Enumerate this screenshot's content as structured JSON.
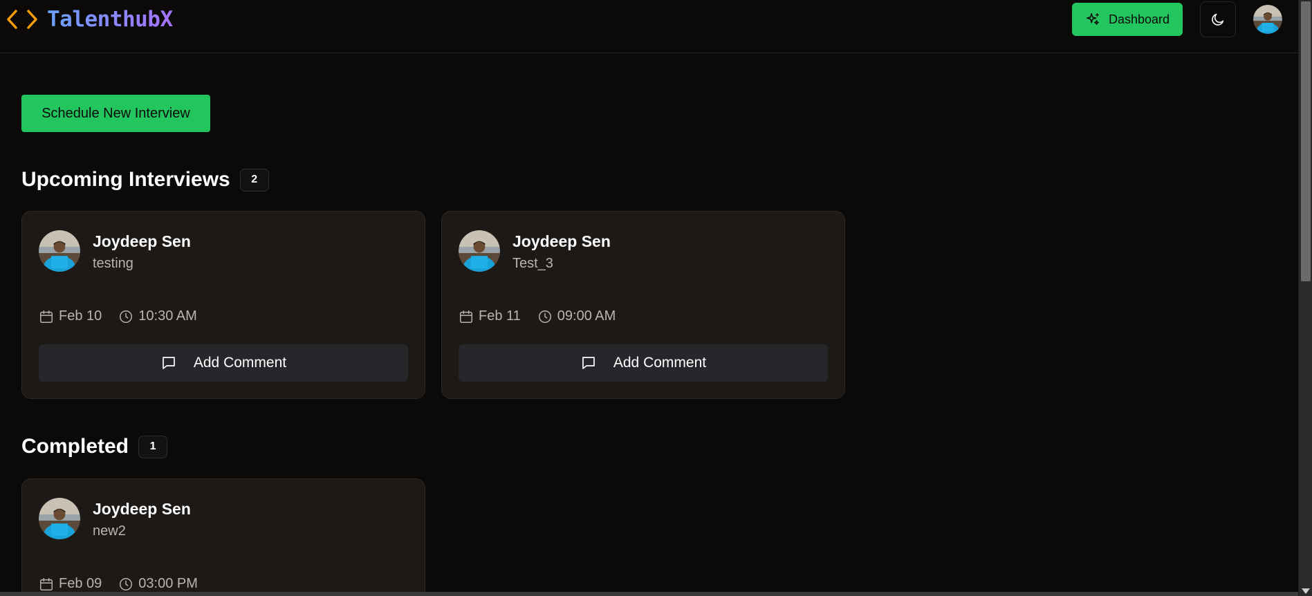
{
  "header": {
    "brand": "TalenthubX",
    "dashboard_label": "Dashboard"
  },
  "main": {
    "schedule_label": "Schedule New Interview",
    "upcoming": {
      "title": "Upcoming Interviews",
      "count": "2",
      "cards": [
        {
          "name": "Joydeep Sen",
          "title": "testing",
          "date": "Feb 10",
          "time": "10:30 AM",
          "comment_label": "Add Comment"
        },
        {
          "name": "Joydeep Sen",
          "title": "Test_3",
          "date": "Feb 11",
          "time": "09:00 AM",
          "comment_label": "Add Comment"
        }
      ]
    },
    "completed": {
      "title": "Completed",
      "count": "1",
      "cards": [
        {
          "name": "Joydeep Sen",
          "title": "new2",
          "date": "Feb 09",
          "time": "03:00 PM"
        }
      ]
    }
  },
  "icons": {
    "logo": "code-brackets-icon",
    "dashboard": "sparkles-icon",
    "theme": "moon-icon",
    "calendar": "calendar-icon",
    "clock": "clock-icon",
    "comment": "message-square-icon"
  },
  "colors": {
    "background": "#0b0a09",
    "accent": "#22c55e",
    "card": "#1c1916",
    "logo_orange": "#f59e0b"
  }
}
